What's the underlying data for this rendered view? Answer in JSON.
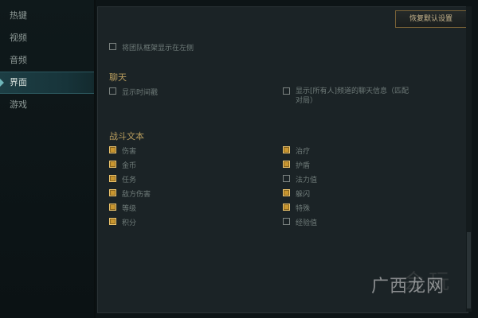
{
  "sidebar": {
    "items": [
      {
        "label": "热键"
      },
      {
        "label": "视频"
      },
      {
        "label": "音频"
      },
      {
        "label": "界面"
      },
      {
        "label": "游戏"
      }
    ],
    "active_index": 3
  },
  "panel": {
    "restore_button": "恢复默认设置",
    "top_option": {
      "label": "将团队框架显示在左侧",
      "checked": false
    },
    "chat": {
      "title": "聊天",
      "options": [
        {
          "label": "显示时间戳",
          "checked": false
        },
        {
          "label": "显示[所有人]频道的聊天信息（匹配对局）",
          "checked": false
        }
      ]
    },
    "combat_text": {
      "title": "战斗文本",
      "left": [
        {
          "label": "伤害",
          "checked": true
        },
        {
          "label": "金币",
          "checked": true
        },
        {
          "label": "任务",
          "checked": true
        },
        {
          "label": "敌方伤害",
          "checked": true
        },
        {
          "label": "等级",
          "checked": true
        },
        {
          "label": "积分",
          "checked": true
        }
      ],
      "right": [
        {
          "label": "治疗",
          "checked": true
        },
        {
          "label": "护盾",
          "checked": true
        },
        {
          "label": "法力值",
          "checked": false
        },
        {
          "label": "躲闪",
          "checked": true
        },
        {
          "label": "特殊",
          "checked": true
        },
        {
          "label": "经验值",
          "checked": false
        }
      ]
    }
  },
  "watermark": {
    "text": "广西龙网",
    "ghost_text": "会玩"
  },
  "colors": {
    "accent_gold": "#c9962f",
    "title_gold": "#b99d5e",
    "active_tab": "#1d3e44"
  }
}
